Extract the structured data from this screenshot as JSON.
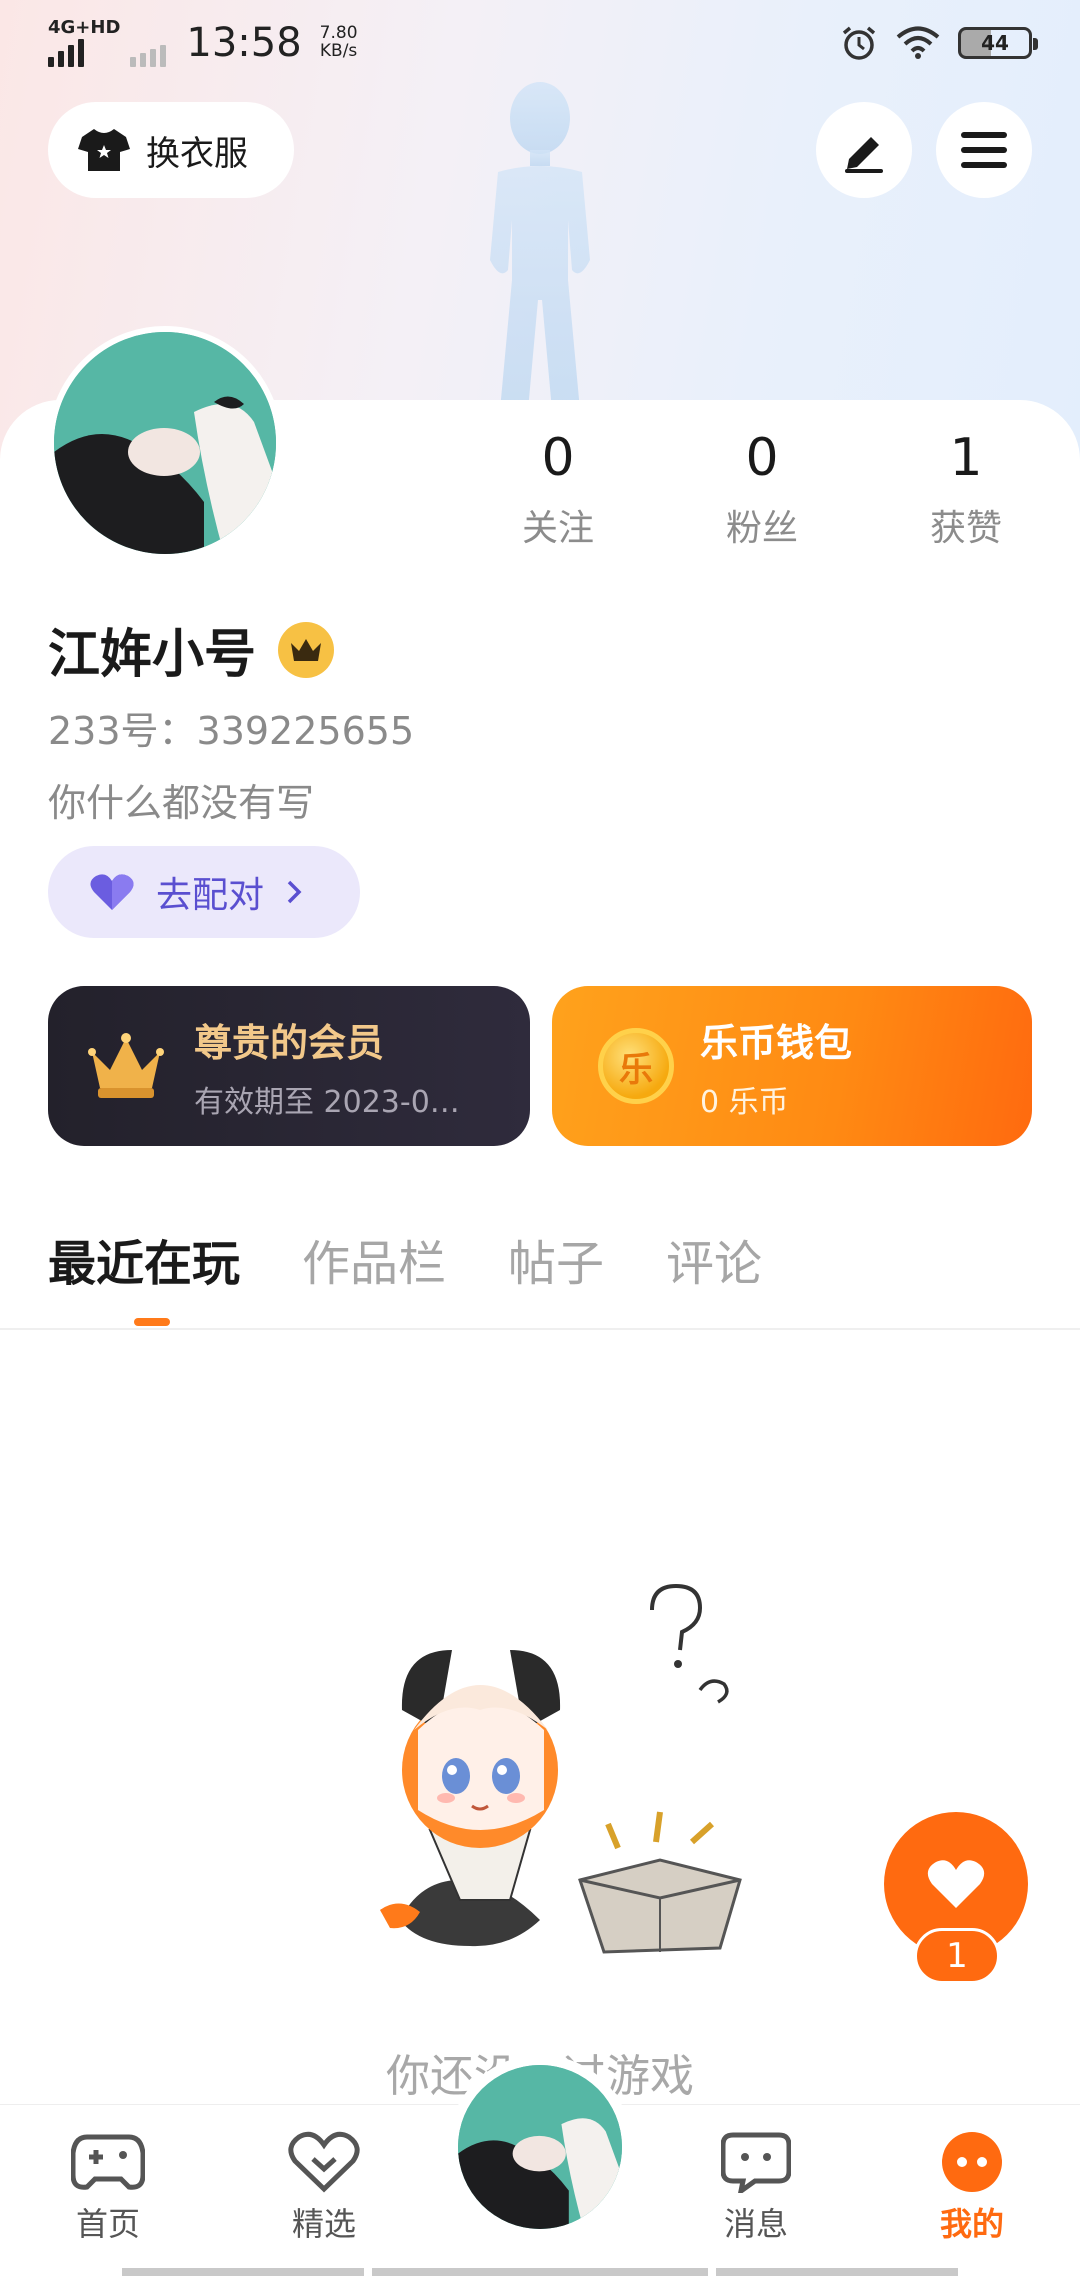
{
  "status_bar": {
    "network": "4G+HD",
    "time": "13:58",
    "speed_value": "7.80",
    "speed_unit": "KB/s",
    "battery": "44"
  },
  "header": {
    "outfit_label": "换衣服",
    "edit_icon": "edit-icon",
    "menu_icon": "menu-icon"
  },
  "profile": {
    "stats": [
      {
        "value": "0",
        "label": "关注"
      },
      {
        "value": "0",
        "label": "粉丝"
      },
      {
        "value": "1",
        "label": "获赞"
      }
    ],
    "name": "江姩小号",
    "uid": "233号：339225655",
    "bio": "你什么都没有写",
    "match_label": "去配对"
  },
  "cards": {
    "vip": {
      "title": "尊贵的会员",
      "subtitle": "有效期至 2023-0…"
    },
    "wallet": {
      "title": "乐币钱包",
      "subtitle": "0 乐币",
      "coin_glyph": "乐"
    }
  },
  "tabs": [
    "最近在玩",
    "作品栏",
    "帖子",
    "评论"
  ],
  "empty_state": {
    "text": "你还没玩过游戏"
  },
  "like_fab": {
    "count": "1"
  },
  "bottom_nav": [
    {
      "label": "首页"
    },
    {
      "label": "精选"
    },
    {
      "label": "消息"
    },
    {
      "label": "我的"
    }
  ],
  "colors": {
    "accent": "#ff6a10",
    "match_text": "#5a4fd0",
    "vip_gold": "#f2c88a"
  }
}
